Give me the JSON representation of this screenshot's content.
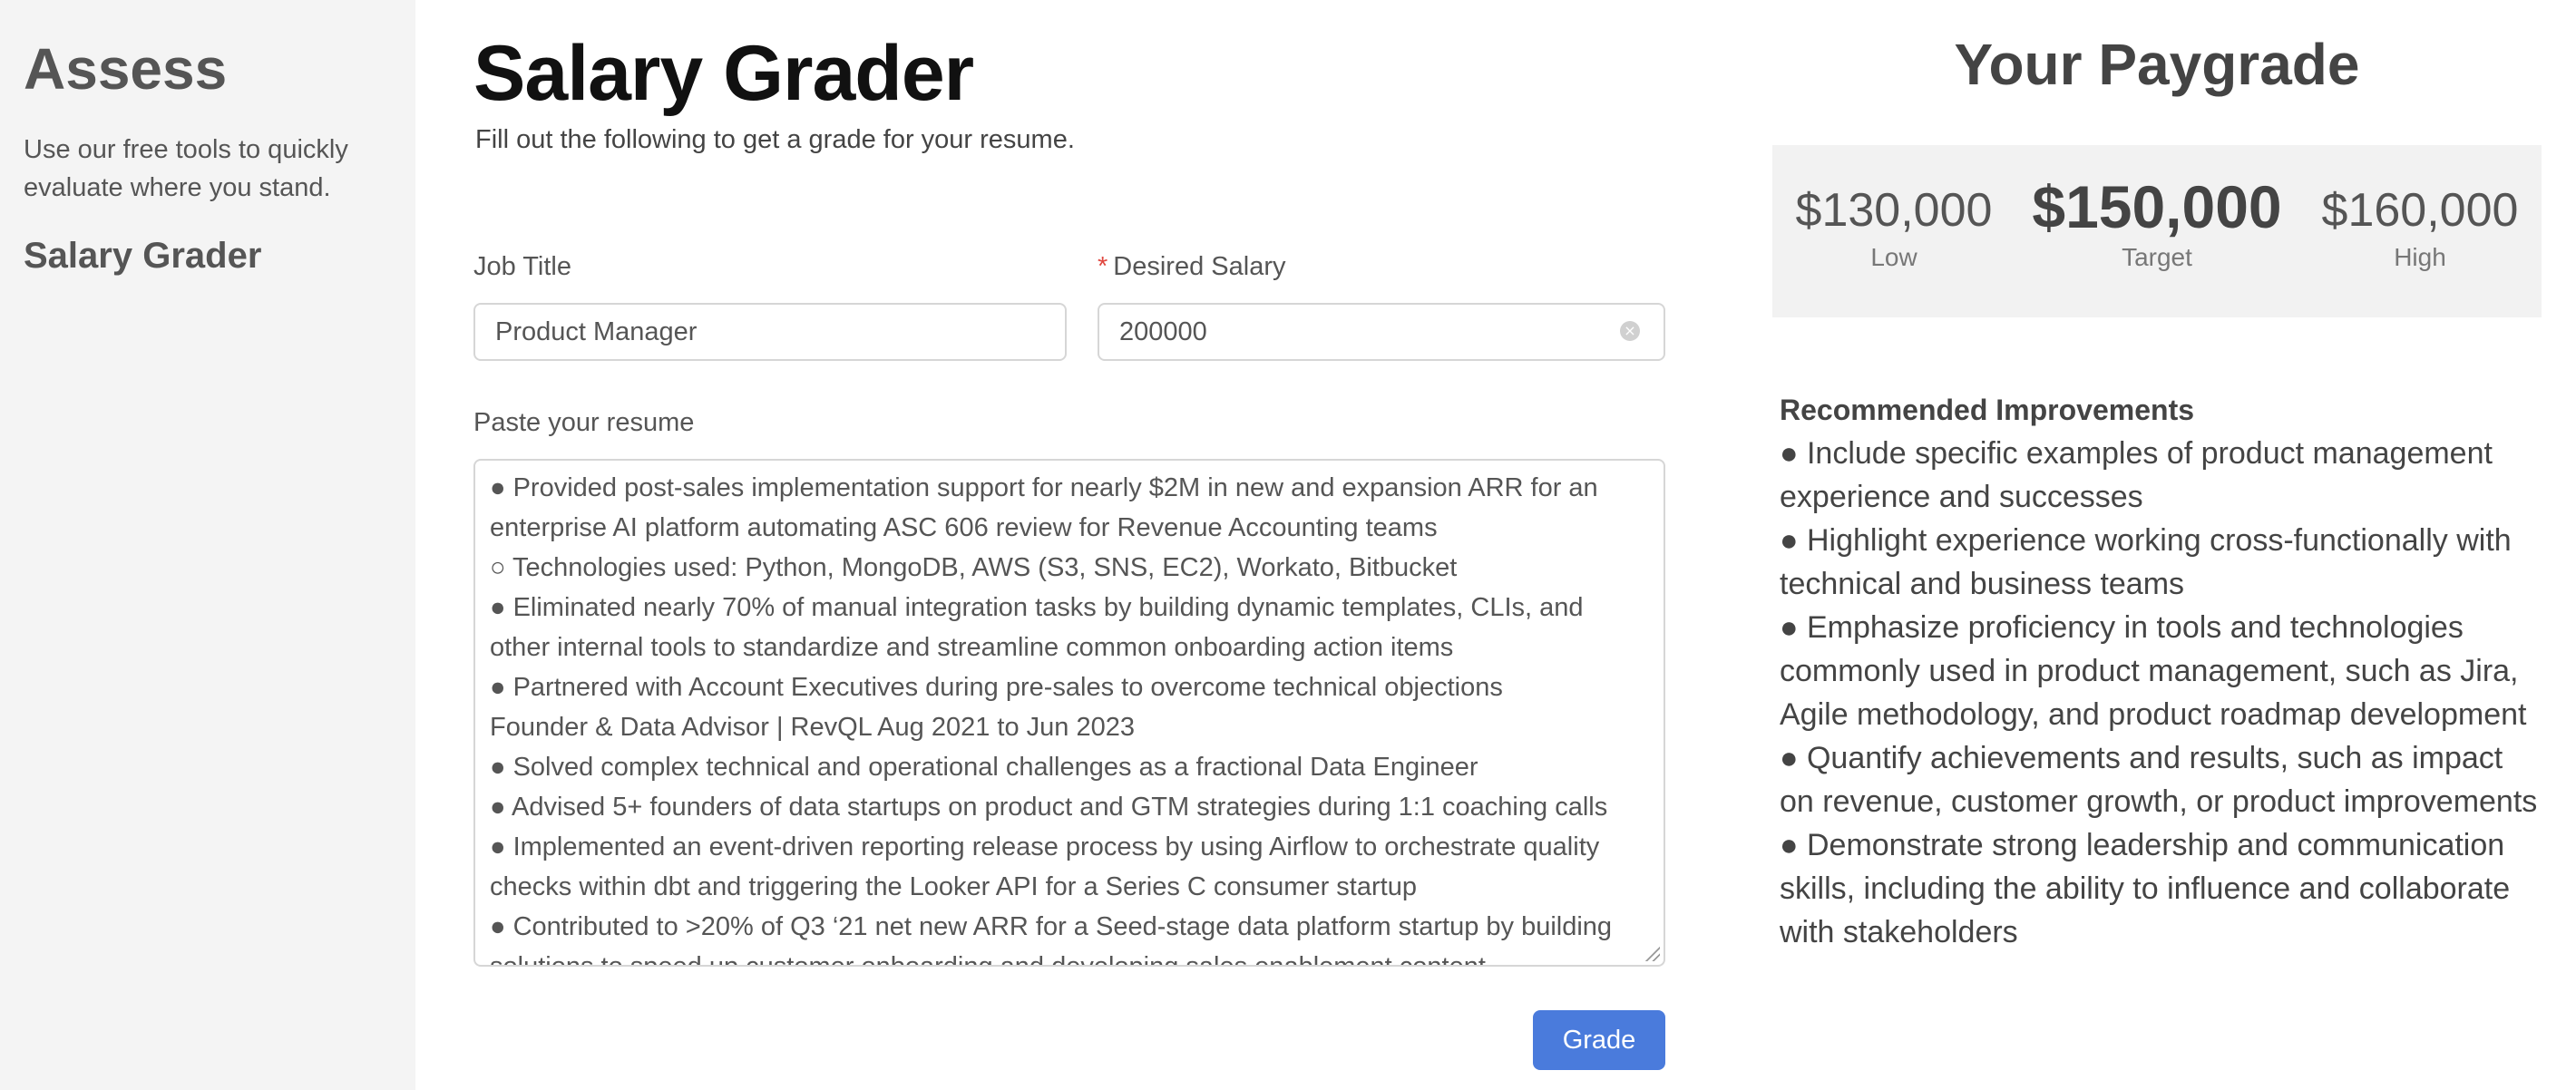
{
  "sidebar": {
    "title": "Assess",
    "blurb": "Use our free tools to quickly evaluate where you stand.",
    "nav_item": "Salary Grader"
  },
  "main": {
    "title": "Salary Grader",
    "subtitle": "Fill out the following to get a grade for your resume.",
    "job_title_label": "Job Title",
    "job_title_value": "Product Manager",
    "desired_salary_required": "*",
    "desired_salary_label": "Desired Salary",
    "desired_salary_value": "200000",
    "resume_label": "Paste your resume",
    "resume_lines": [
      "● Provided post-sales implementation support for nearly $2M in new and expansion ARR for an",
      "enterprise AI platform automating ASC 606 review for Revenue Accounting teams",
      "○ Technologies used: Python, MongoDB, AWS (S3, SNS, EC2), Workato, Bitbucket",
      "● Eliminated nearly 70% of manual integration tasks by building dynamic templates, CLIs, and",
      "other internal tools to standardize and streamline common onboarding action items",
      "● Partnered with Account Executives during pre-sales to overcome technical objections",
      "Founder & Data Advisor | RevQL Aug 2021 to Jun 2023",
      "● Solved complex technical and operational challenges as a fractional Data Engineer",
      "● Advised 5+ founders of data startups on product and GTM strategies during 1:1 coaching calls",
      "● Implemented an event-driven reporting release process by using Airflow to orchestrate quality",
      "checks within dbt and triggering the Looker API for a Series C consumer startup",
      "● Contributed to >20% of Q3 ‘21 net new ARR for a Seed-stage data platform startup by building",
      "solutions to speed up customer onboarding and developing sales enablement content"
    ],
    "grade_button": "Grade"
  },
  "paygrade": {
    "title": "Your Paygrade",
    "low_amount": "$130,000",
    "low_label": "Low",
    "target_amount": "$150,000",
    "target_label": "Target",
    "high_amount": "$160,000",
    "high_label": "High"
  },
  "improvements": {
    "heading": "Recommended Improvements",
    "items": [
      "● Include specific examples of product management experience and successes",
      "● Highlight experience working cross-functionally with technical and business teams",
      "● Emphasize proficiency in tools and technologies commonly used in product management, such as Jira, Agile methodology, and product roadmap development",
      "● Quantify achievements and results, such as impact on revenue, customer growth, or product improvements",
      "● Demonstrate strong leadership and communication skills, including the ability to influence and collaborate with stakeholders"
    ]
  },
  "colors": {
    "accent": "#4a7bdc",
    "sidebar_bg": "#f4f4f4",
    "required": "#e0473f"
  },
  "icons": {
    "clear": "clear-icon",
    "resize": "resize-grip-icon"
  }
}
